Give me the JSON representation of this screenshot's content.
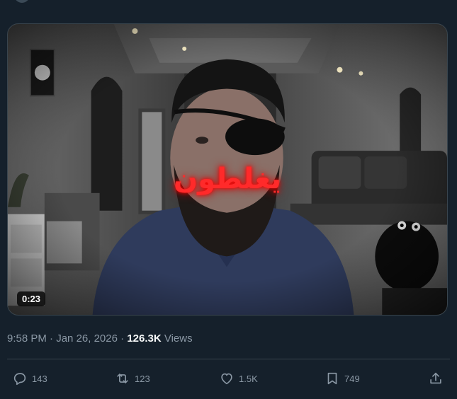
{
  "tweet": {
    "media": {
      "overlay_text": "يغلطون",
      "duration": "0:23"
    },
    "meta": {
      "time": "9:58 PM",
      "separator1": " · ",
      "date": "Jan 26, 2026",
      "separator2": " · ",
      "views_count": "126.3K",
      "views_label": " Views"
    },
    "actions": {
      "replies": "143",
      "reposts": "123",
      "likes": "1.5K",
      "bookmarks": "749"
    }
  },
  "colors": {
    "background": "#15202b",
    "border": "#38444d",
    "muted_text": "#8b98a5",
    "primary_text": "#f7f9f9",
    "overlay_red": "#ff2a2a"
  },
  "icons": {
    "reply": "reply-icon",
    "repost": "repost-icon",
    "like": "heart-icon",
    "bookmark": "bookmark-icon",
    "share": "share-icon"
  }
}
